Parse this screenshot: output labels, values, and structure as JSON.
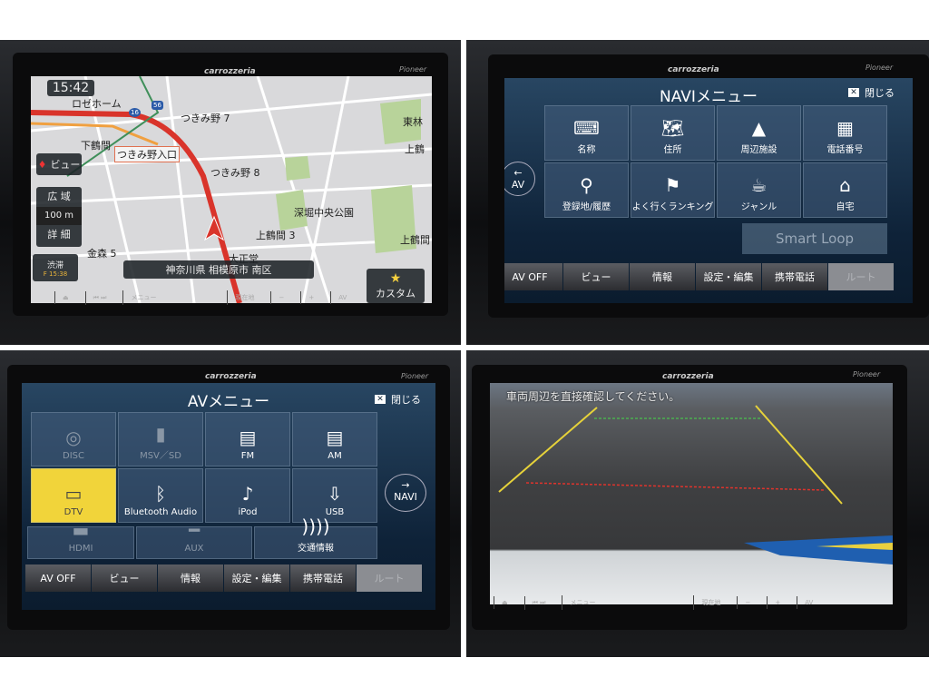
{
  "brand": "carrozzeria",
  "maker": "Pioneer",
  "hardware_buttons": {
    "menu": "メニュー",
    "current_location": "現在地",
    "minus": "−",
    "plus": "+",
    "av": "AV"
  },
  "map_screen": {
    "clock": "15:42",
    "traffic_time": "F 15:38",
    "traffic_label": "渋滞",
    "view_button": "ビュー",
    "zoom_wide": "広 域",
    "scale": "100 m",
    "zoom_detail": "詳 細",
    "address": "神奈川県 相模原市 南区",
    "custom_button": "カスタム",
    "route_numbers": [
      "16",
      "56"
    ],
    "labels": [
      "ロゼホーム",
      "下鶴間",
      "つきみ野入口",
      "つきみ野 7",
      "つきみ野 8",
      "深堀中央公園",
      "上鶴間 3",
      "金森 5",
      "大正堂",
      "東林",
      "上鶴",
      "上鶴間"
    ],
    "colors": {
      "route": "#d9342b",
      "park": "#b8d39a",
      "road": "#ffffff"
    }
  },
  "navi_menu": {
    "title": "NAVIメニュー",
    "close": "閉じる",
    "back_av": {
      "arrow": "←",
      "label": "AV"
    },
    "items": [
      {
        "label": "名称",
        "icon": "keyboard-icon"
      },
      {
        "label": "住所",
        "icon": "map-icon"
      },
      {
        "label": "周辺施設",
        "icon": "poi-icon"
      },
      {
        "label": "電話番号",
        "icon": "phone-keypad-icon"
      },
      {
        "label": "登録地/履歴",
        "icon": "pins-icon"
      },
      {
        "label": "よく行くランキング",
        "icon": "checkered-flag-icon"
      },
      {
        "label": "ジャンル",
        "icon": "food-icon"
      },
      {
        "label": "自宅",
        "icon": "house-icon"
      }
    ],
    "smart_loop": "Smart Loop"
  },
  "av_menu": {
    "title": "AVメニュー",
    "close": "閉じる",
    "to_navi": {
      "arrow": "→",
      "label": "NAVI"
    },
    "items": [
      {
        "label": "DISC",
        "icon": "disc-icon",
        "state": "disabled"
      },
      {
        "label": "MSV／SD",
        "icon": "sd-card-icon",
        "state": "disabled"
      },
      {
        "label": "FM",
        "icon": "radio-icon",
        "state": "normal"
      },
      {
        "label": "AM",
        "icon": "radio-icon",
        "state": "normal"
      },
      {
        "label": "DTV",
        "icon": "tv-icon",
        "state": "selected"
      },
      {
        "label": "Bluetooth Audio",
        "icon": "bluetooth-icon",
        "state": "normal"
      },
      {
        "label": "iPod",
        "icon": "music-note-icon",
        "state": "normal"
      },
      {
        "label": "USB",
        "icon": "usb-icon",
        "state": "normal"
      },
      {
        "label": "HDMI",
        "icon": "hdmi-icon",
        "state": "disabled"
      },
      {
        "label": "AUX",
        "icon": "aux-icon",
        "state": "disabled"
      },
      {
        "label": "交通情報",
        "icon": "signal-icon",
        "state": "normal"
      }
    ],
    "selected_color": "#f1d43a"
  },
  "bottom_tabs": [
    "AV OFF",
    "ビュー",
    "情報",
    "設定・編集",
    "携帯電話",
    "ルート"
  ],
  "camera": {
    "warning": "車両周辺を直接確認してください。",
    "guide_colors": {
      "side": "#e6d23a",
      "far": "#4caf50",
      "near": "#e0332c"
    }
  }
}
